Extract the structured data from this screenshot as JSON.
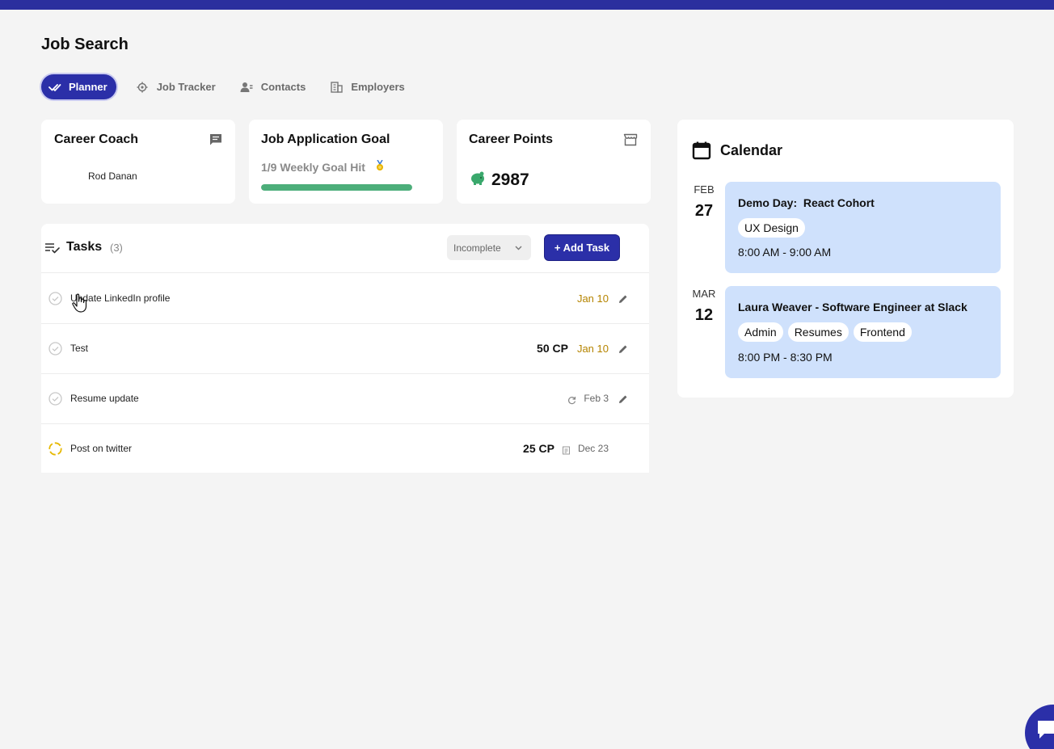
{
  "page": {
    "title": "Job Search"
  },
  "tabs": [
    {
      "label": "Planner",
      "icon": "double-check-icon",
      "active": true
    },
    {
      "label": "Job Tracker",
      "icon": "target-icon",
      "active": false
    },
    {
      "label": "Contacts",
      "icon": "contacts-icon",
      "active": false
    },
    {
      "label": "Employers",
      "icon": "building-icon",
      "active": false
    }
  ],
  "coach": {
    "title": "Career Coach",
    "name": "Rod Danan",
    "icon": "message-icon"
  },
  "goal": {
    "title": "Job Application Goal",
    "text": "1/9 Weekly Goal Hit",
    "progress": 1.0,
    "medal": "medal-icon"
  },
  "points": {
    "title": "Career Points",
    "value": "2987",
    "icon": "piggy-bank-icon"
  },
  "tasks": {
    "title": "Tasks",
    "count": "(3)",
    "filter": "Incomplete",
    "add_label": "+ Add Task",
    "items": [
      {
        "name": "Update LinkedIn profile",
        "cp": "",
        "due": "Jan 10",
        "due_style": "highlight",
        "status": "incomplete"
      },
      {
        "name": "Test",
        "cp": "50 CP",
        "due": "Jan 10",
        "due_style": "highlight",
        "status": "incomplete"
      },
      {
        "name": "Resume update",
        "cp": "",
        "due": "Feb 3",
        "due_style": "recurring",
        "status": "incomplete"
      },
      {
        "name": "Post on twitter",
        "cp": "25 CP",
        "due": "Dec 23",
        "due_style": "note",
        "status": "in-progress"
      }
    ]
  },
  "calendar": {
    "title": "Calendar",
    "events": [
      {
        "month": "FEB",
        "day": "27",
        "title": "Demo Day:  React Cohort",
        "tags": [
          "UX Design"
        ],
        "time": "8:00 AM - 9:00 AM"
      },
      {
        "month": "MAR",
        "day": "12",
        "title": "Laura Weaver - Software Engineer at Slack",
        "tags": [
          "Admin",
          "Resumes",
          "Frontend"
        ],
        "time": "8:00 PM - 8:30 PM"
      }
    ]
  },
  "colors": {
    "primary": "#2b2fa8",
    "event_bg": "#cfe1fc",
    "progress": "#4cae7a",
    "due_highlight": "#b58400"
  }
}
